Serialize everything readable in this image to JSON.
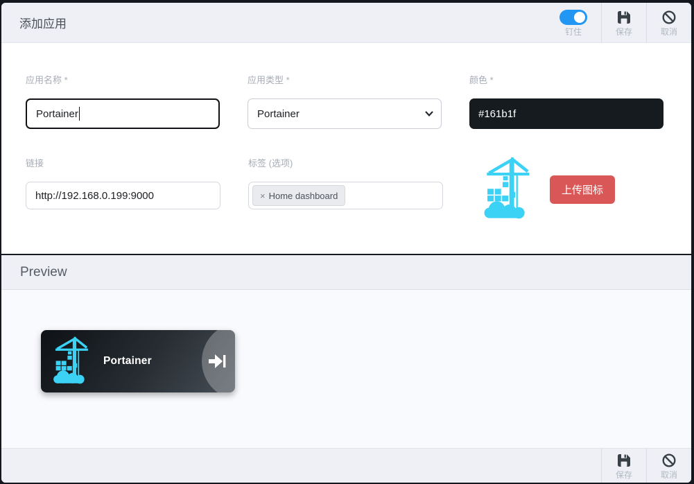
{
  "window": {
    "title": "添加应用"
  },
  "colors": {
    "toggle_blue": "#2196f3",
    "brand_cyan": "#3bd2f5",
    "danger_red": "#da5757",
    "color_field_value_bg": "#161b1f",
    "bar_bg": "#eef0f5"
  },
  "header": {
    "title": "添加应用",
    "pin": {
      "label": "钉住",
      "state": "on",
      "icon": "toggle-on-icon"
    },
    "save": {
      "label": "保存",
      "icon": "floppy-disk-icon"
    },
    "cancel": {
      "label": "取消",
      "icon": "cancel-circle-icon"
    }
  },
  "form": {
    "fields": {
      "name": {
        "label": "应用名称 *",
        "value": "Portainer"
      },
      "type": {
        "label": "应用类型 *",
        "value": "Portainer"
      },
      "color": {
        "label": "颜色 *",
        "value": "#161b1f"
      },
      "url": {
        "label": "链接",
        "value": "http://192.168.0.199:9000"
      },
      "tags": {
        "label": "标签 (选项)",
        "chips": [
          {
            "remove": "×",
            "label": "Home dashboard"
          }
        ]
      }
    },
    "upload_button_label": "上传图标",
    "app_icon": "portainer-logo"
  },
  "preview": {
    "section_title": "Preview",
    "card": {
      "title": "Portainer",
      "icon": "portainer-logo",
      "action_icon": "enter-arrow-icon"
    }
  },
  "footer": {
    "save": {
      "label": "保存",
      "icon": "floppy-disk-icon"
    },
    "cancel": {
      "label": "取消",
      "icon": "cancel-circle-icon"
    }
  }
}
